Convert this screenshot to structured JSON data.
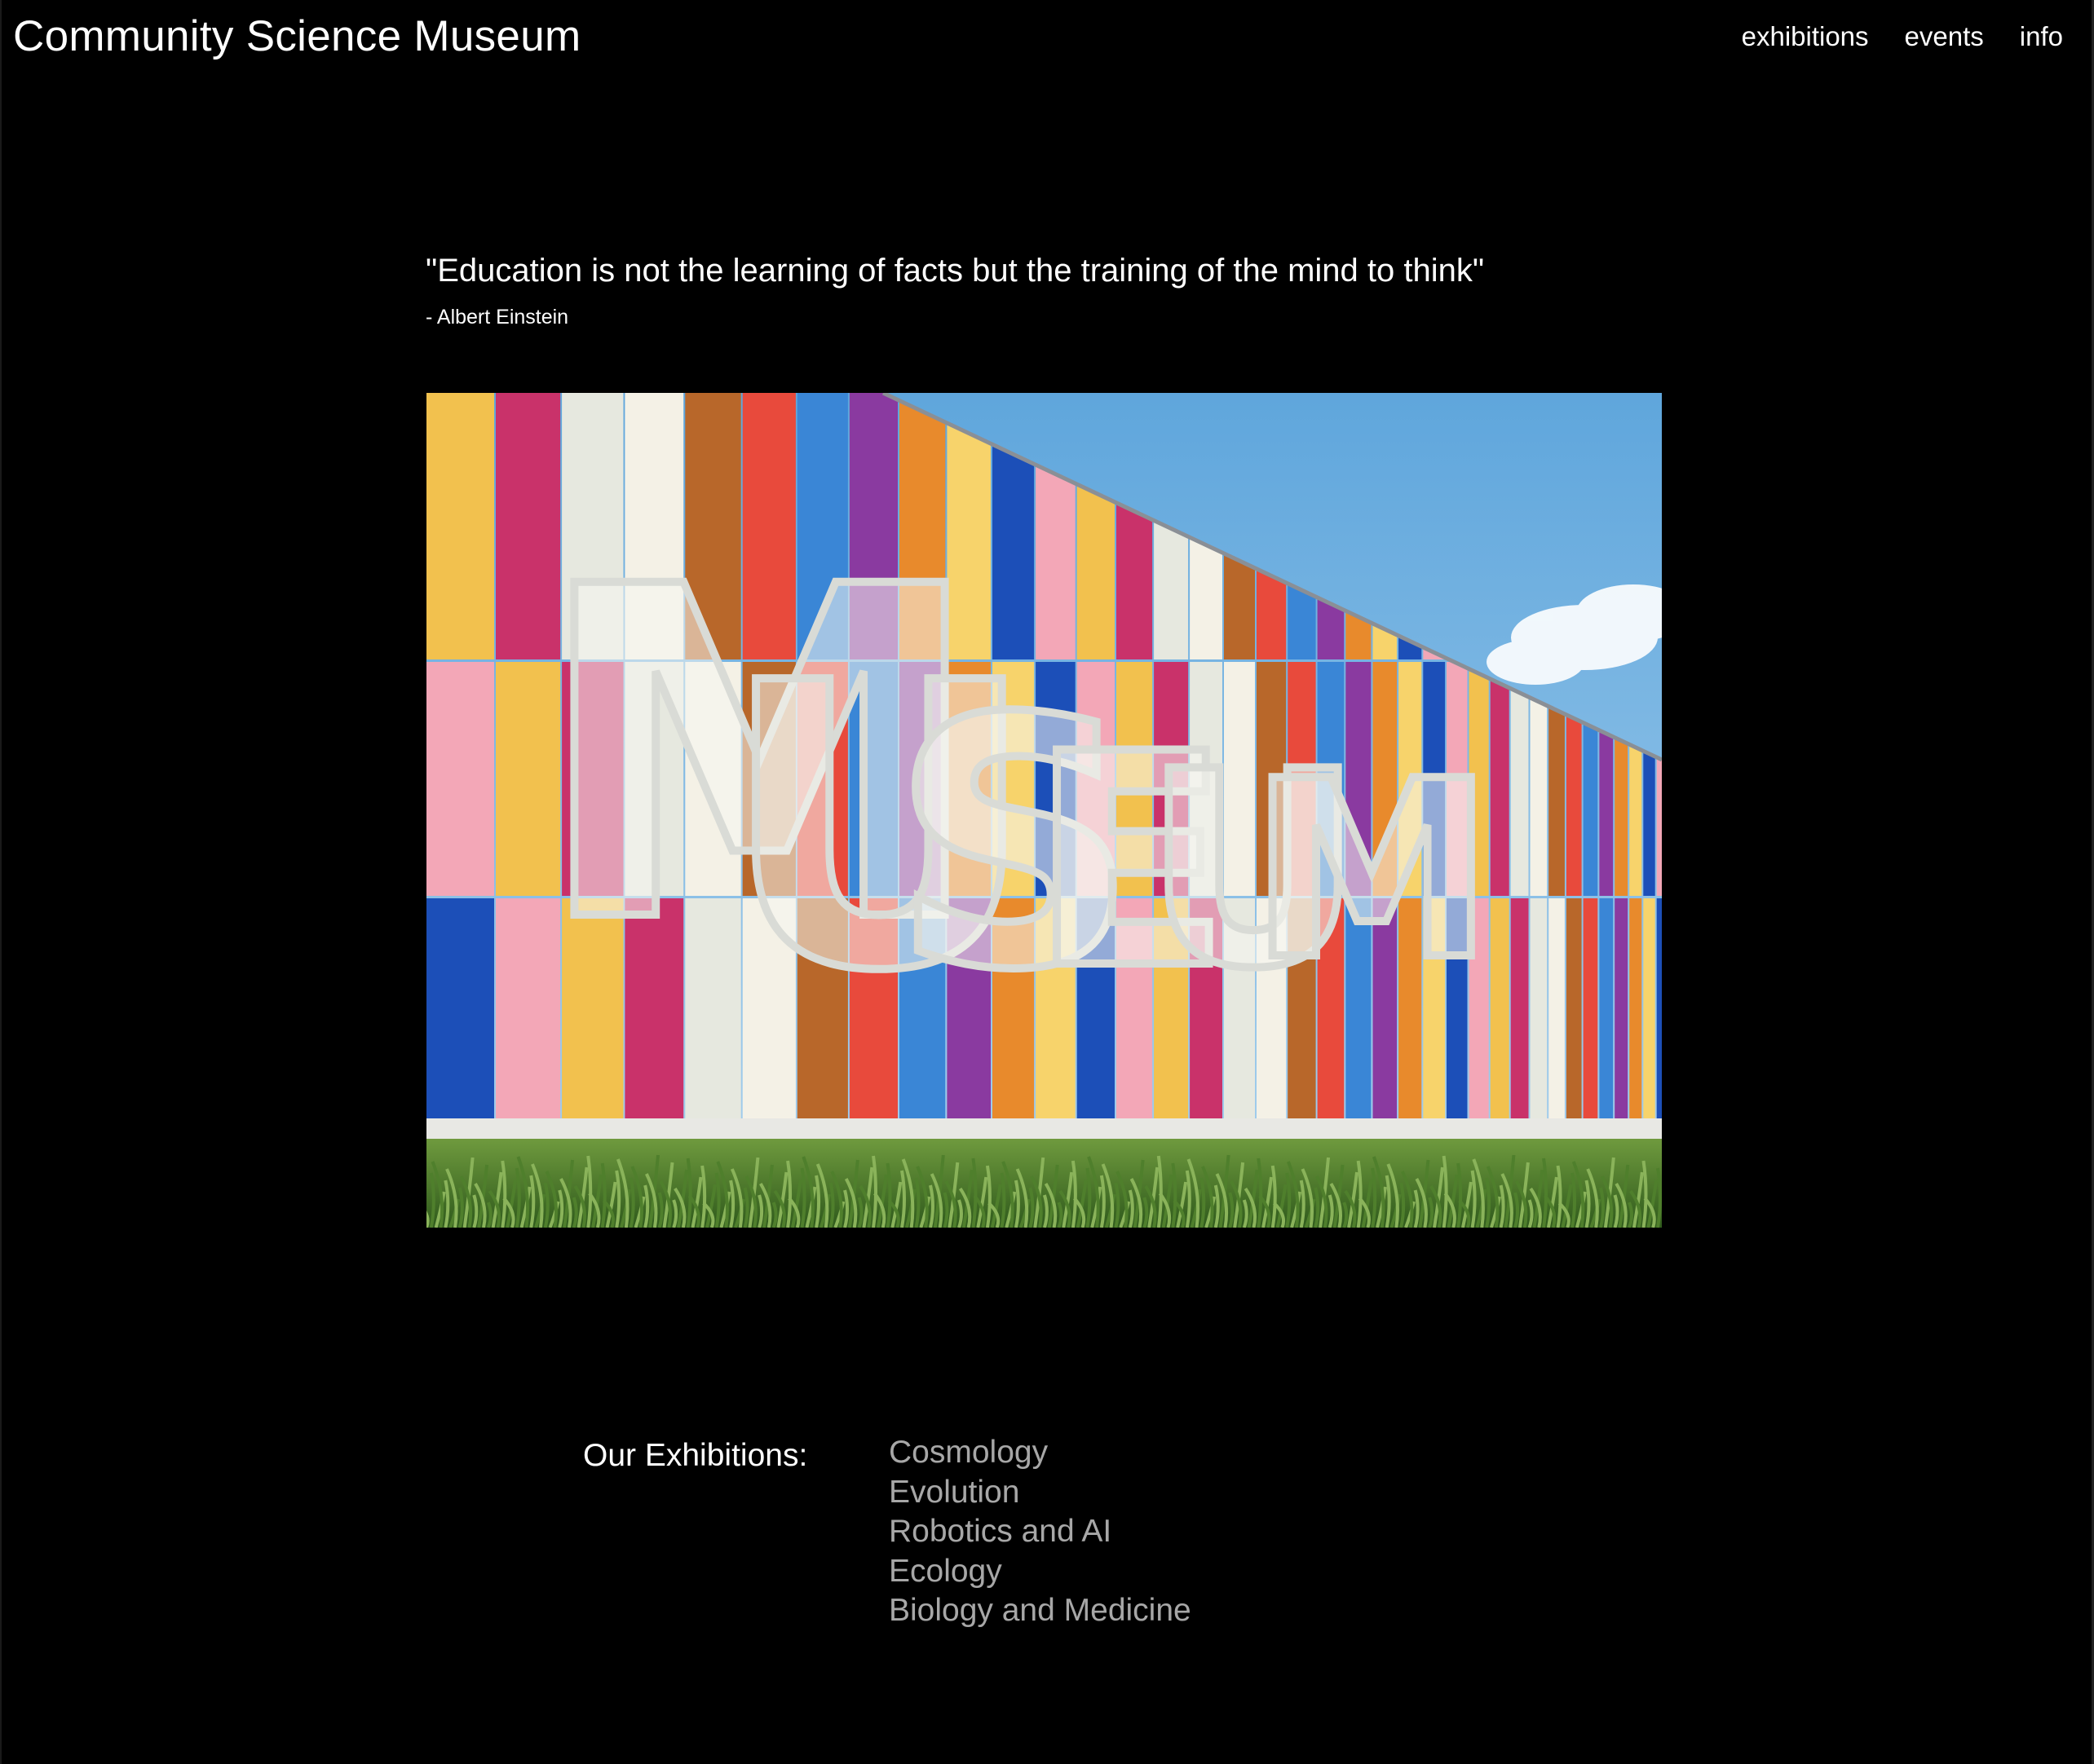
{
  "header": {
    "site_title": "Community Science Museum",
    "nav": [
      {
        "label": "exhibitions"
      },
      {
        "label": "events"
      },
      {
        "label": "info"
      }
    ]
  },
  "quote": {
    "text": "\"Education is not the learning of facts but the training of the mind to think\"",
    "author": "- Albert Einstein"
  },
  "hero": {
    "sign_text": "MUSEUM"
  },
  "exhibitions": {
    "label": "Our Exhibitions:",
    "items": [
      "Cosmology",
      "Evolution",
      "Robotics and AI",
      "Ecology",
      "Biology and Medicine"
    ]
  },
  "colors": {
    "background": "#000000",
    "text": "#ffffff",
    "exhibition_link": "#a7a7a7"
  }
}
